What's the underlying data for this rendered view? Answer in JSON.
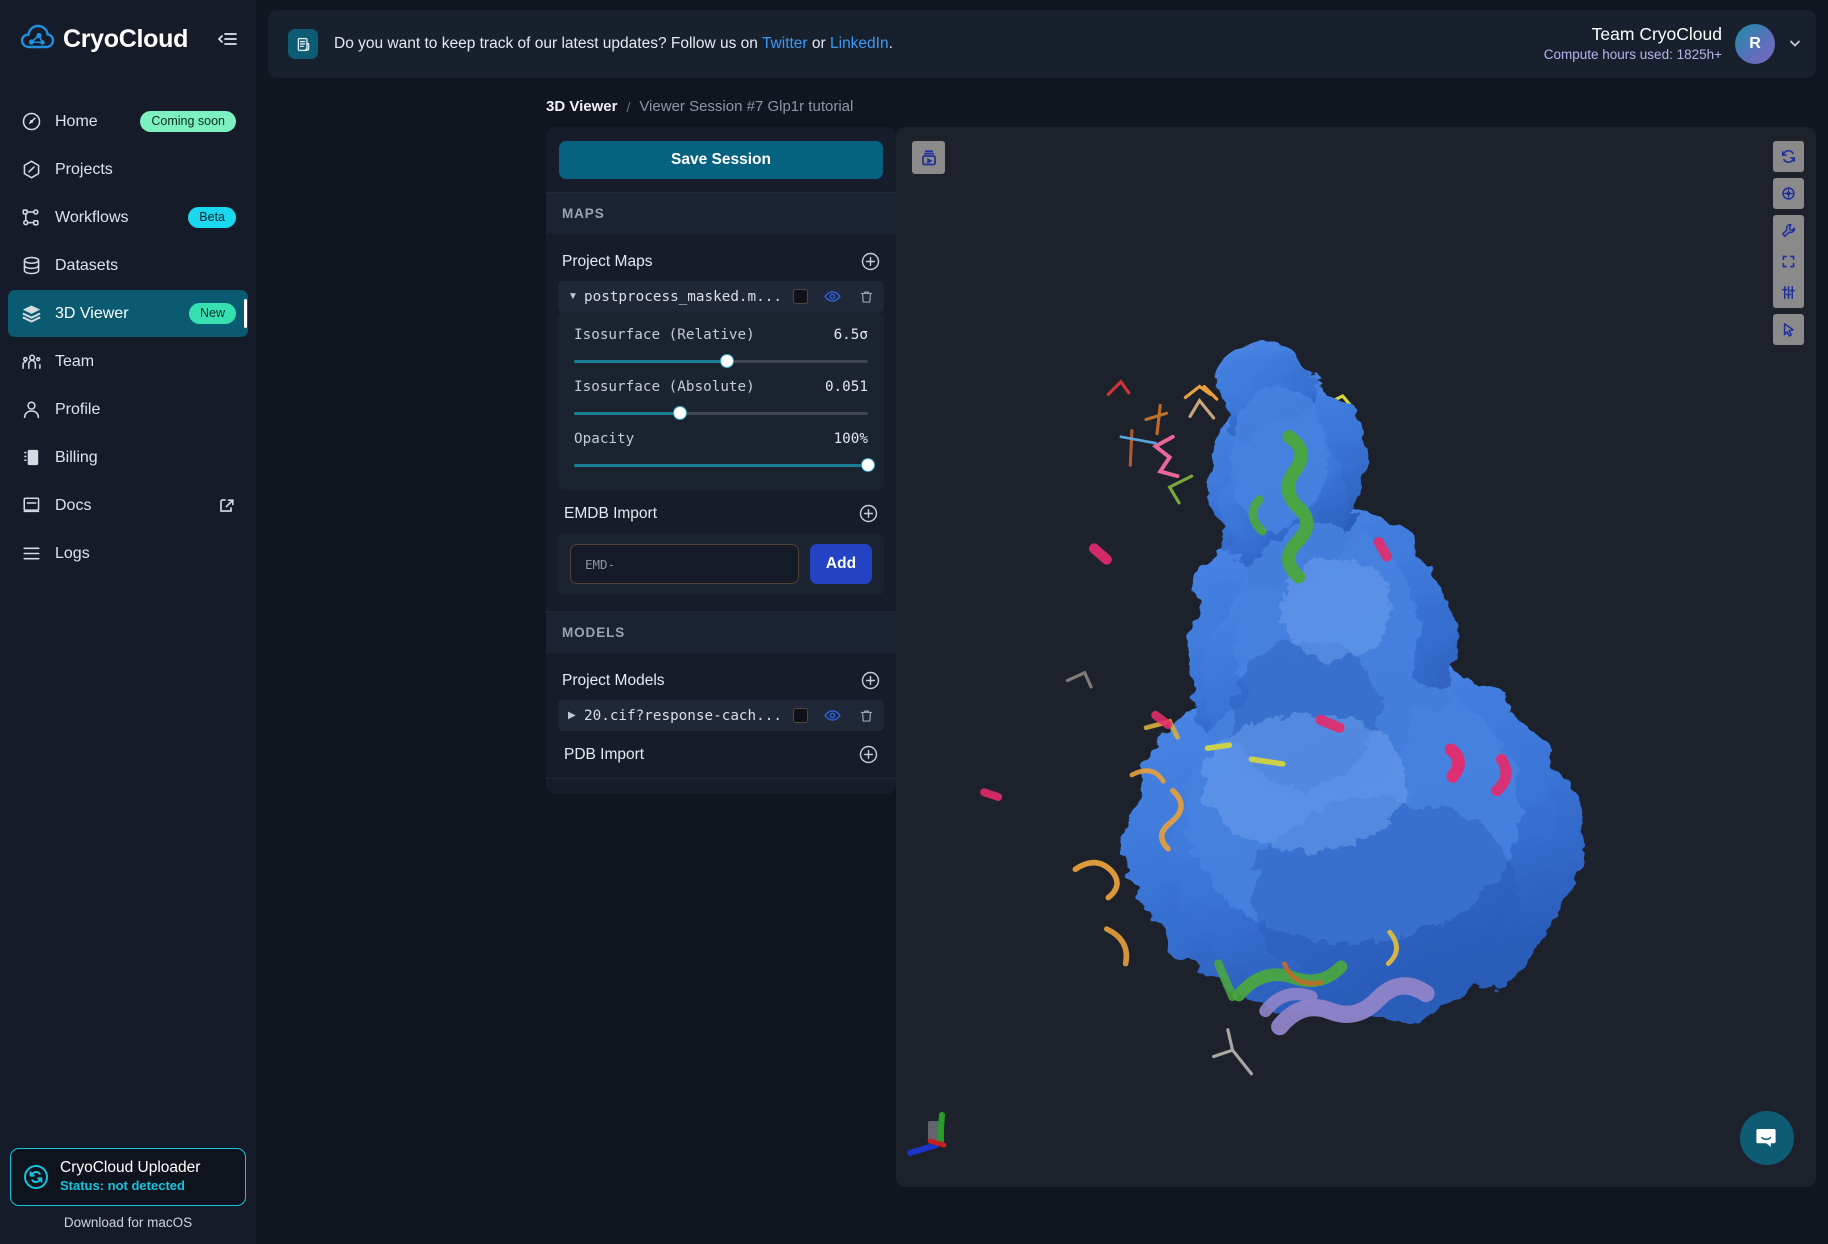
{
  "brand": {
    "name": "CryoCloud",
    "logo_icon": "cryocloud-logo-icon",
    "collapse_icon": "collapse-sidebar-icon"
  },
  "sidebar": {
    "items": [
      {
        "label": "Home",
        "icon": "gauge-icon",
        "badge": "Coming soon",
        "badge_style": "mint",
        "active": false
      },
      {
        "label": "Projects",
        "icon": "hexagon-icon",
        "badge": "",
        "badge_style": "",
        "active": false
      },
      {
        "label": "Workflows",
        "icon": "nodes-icon",
        "badge": "Beta",
        "badge_style": "cyan",
        "active": false
      },
      {
        "label": "Datasets",
        "icon": "database-icon",
        "badge": "",
        "badge_style": "",
        "active": false
      },
      {
        "label": "3D Viewer",
        "icon": "layers-icon",
        "badge": "New",
        "badge_style": "new",
        "active": true
      },
      {
        "label": "Team",
        "icon": "people-icon",
        "badge": "",
        "badge_style": "",
        "active": false
      },
      {
        "label": "Profile",
        "icon": "person-icon",
        "badge": "",
        "badge_style": "",
        "active": false
      },
      {
        "label": "Billing",
        "icon": "book-icon",
        "badge": "",
        "badge_style": "",
        "active": false
      },
      {
        "label": "Docs",
        "icon": "docs-icon",
        "badge": "",
        "badge_style": "",
        "active": false,
        "external": true
      },
      {
        "label": "Logs",
        "icon": "list-icon",
        "badge": "",
        "badge_style": "",
        "active": false
      }
    ],
    "uploader": {
      "title": "CryoCloud Uploader",
      "status": "Status: not detected",
      "download": "Download for macOS",
      "icon": "uploader-sync-icon",
      "accent": "#16c4dd"
    }
  },
  "topbar": {
    "announcement_icon": "news-icon",
    "announcement_prefix": "Do you want to keep track of our latest updates? Follow us on ",
    "link_twitter": "Twitter",
    "announcement_mid": " or ",
    "link_linkedin": "LinkedIn",
    "announcement_suffix": ".",
    "team_name": "Team CryoCloud",
    "compute_hours": "Compute hours used: 1825h+",
    "avatar_initial": "R",
    "chevron_icon": "chevron-down-icon"
  },
  "breadcrumb": {
    "current": "3D Viewer",
    "separator": "/",
    "sub": "Viewer Session #7 Glp1r tutorial"
  },
  "panel": {
    "save_label": "Save Session",
    "maps_section": "MAPS",
    "models_section": "MODELS",
    "project_maps": {
      "title": "Project Maps",
      "add_icon": "plus-circle-icon",
      "item": {
        "name": "postprocess_masked.m...",
        "expanded": true,
        "caret_icon": "caret-down-icon",
        "color_swatch": "#0e1118",
        "visibility_icon": "eye-icon",
        "delete_icon": "trash-icon"
      },
      "controls": [
        {
          "label": "Isosurface (Relative)",
          "value": "6.5σ",
          "percent": 52
        },
        {
          "label": "Isosurface (Absolute)",
          "value": "0.051",
          "percent": 36
        },
        {
          "label": "Opacity",
          "value": "100%",
          "percent": 100
        }
      ]
    },
    "emdb_import": {
      "title": "EMDB Import",
      "add_icon": "plus-circle-icon",
      "placeholder": "EMD-",
      "value": "",
      "button": "Add"
    },
    "project_models": {
      "title": "Project Models",
      "add_icon": "plus-circle-icon",
      "item": {
        "name": "20.cif?response-cach...",
        "expanded": false,
        "caret_icon": "caret-right-icon",
        "color_swatch": "#0e1118",
        "visibility_icon": "eye-icon",
        "delete_icon": "trash-icon"
      }
    },
    "pdb_import": {
      "title": "PDB Import",
      "add_icon": "plus-circle-icon"
    }
  },
  "viewer": {
    "snapshot_icon": "archive-video-icon",
    "tools": [
      {
        "icon": "reset-rotation-icon",
        "group": 0
      },
      {
        "icon": "focus-camera-icon",
        "group": 1
      },
      {
        "icon": "wrench-settings-icon",
        "group": 2
      },
      {
        "icon": "expand-fullscreen-icon",
        "group": 2
      },
      {
        "icon": "sliders-controls-icon",
        "group": 2
      },
      {
        "icon": "select-cursor-icon",
        "group": 3
      }
    ],
    "axis_widget_icon": "xyz-axis-icon",
    "molecule": {
      "map_color": "#3b76d8",
      "model_colors": [
        "#4aa83c",
        "#8f84c8",
        "#e8a03a",
        "#e62a6b",
        "#d8d83a",
        "#c9a57e",
        "#e8669a"
      ]
    },
    "intercom_icon": "chat-bubble-icon"
  }
}
